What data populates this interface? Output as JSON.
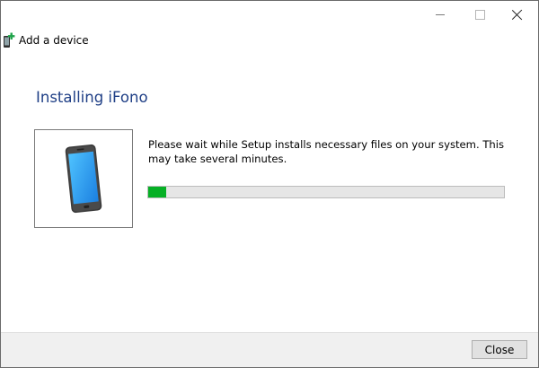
{
  "window": {
    "controls": {
      "minimize_icon": "minimize-icon",
      "maximize_icon": "maximize-icon",
      "close_icon": "close-icon"
    }
  },
  "wizard": {
    "title": "Add a device",
    "icon": "add-device-icon",
    "heading": "Installing iFono",
    "heading_color": "#1f3f86",
    "device_image": "phone-icon",
    "message": "Please wait while Setup installs necessary files on your system. This may take several minutes.",
    "progress_fraction": 0.05,
    "progress_color": "#06b025"
  },
  "footer": {
    "close_label": "Close"
  }
}
